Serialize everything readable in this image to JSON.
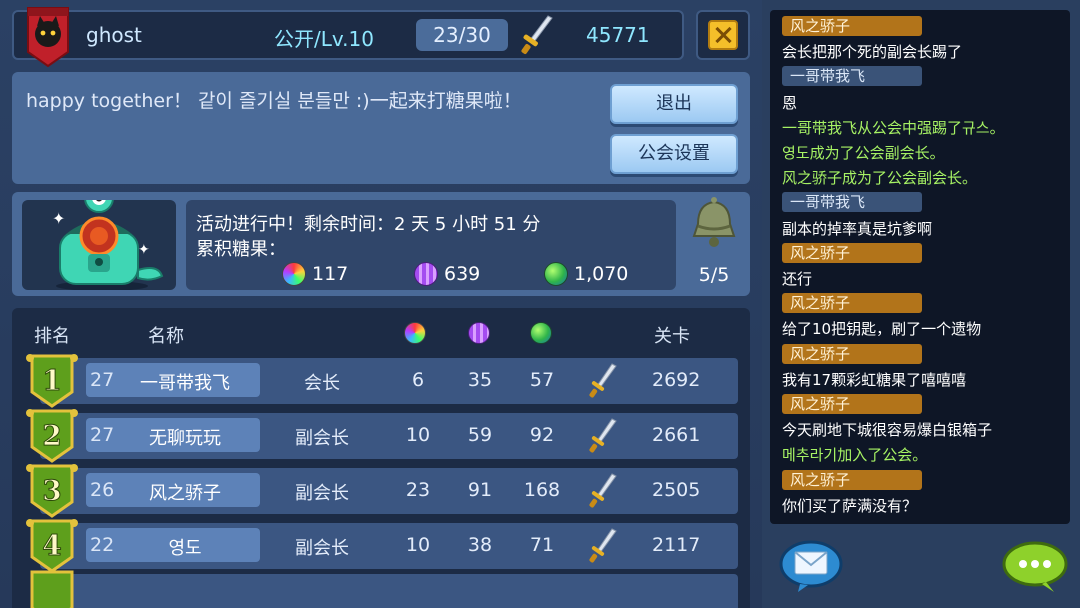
{
  "header": {
    "player_name": "ghost",
    "guild_level": "公开/Lv.10",
    "member_count": "23/30",
    "score": "45771"
  },
  "notice": {
    "text": "happy together！ 같이 즐기실 분들만 :)一起来打糖果啦！",
    "exit_label": "退出",
    "settings_label": "公会设置"
  },
  "activity": {
    "status_text": "活动进行中！剩余时间：2 天 5 小时 51 分",
    "candy_label": "累积糖果：",
    "candy_rainbow": "117",
    "candy_purple": "639",
    "candy_green": "1,070",
    "bell_count": "5/5"
  },
  "table": {
    "col_rank": "排名",
    "col_name": "名称",
    "col_stage": "关卡",
    "rows": [
      {
        "rank": "1",
        "level": "27",
        "name": "一哥带我飞",
        "role": "会长",
        "rainbow": "6",
        "purple": "35",
        "green": "57",
        "stage": "2692"
      },
      {
        "rank": "2",
        "level": "27",
        "name": "无聊玩玩",
        "role": "副会长",
        "rainbow": "10",
        "purple": "59",
        "green": "92",
        "stage": "2661"
      },
      {
        "rank": "3",
        "level": "26",
        "name": "风之骄子",
        "role": "副会长",
        "rainbow": "23",
        "purple": "91",
        "green": "168",
        "stage": "2505"
      },
      {
        "rank": "4",
        "level": "22",
        "name": "영도",
        "role": "副会长",
        "rainbow": "10",
        "purple": "38",
        "green": "71",
        "stage": "2117"
      }
    ]
  },
  "chat": {
    "messages": [
      {
        "kind": "tag",
        "style": "orange",
        "text": "风之骄子"
      },
      {
        "kind": "text",
        "style": "white",
        "text": "会长把那个死的副会长踢了"
      },
      {
        "kind": "tag",
        "style": "blue",
        "text": "一哥带我飞"
      },
      {
        "kind": "text",
        "style": "white",
        "text": "恩"
      },
      {
        "kind": "text",
        "style": "green",
        "text": "一哥带我飞从公会中强踢了규스。"
      },
      {
        "kind": "text",
        "style": "green",
        "text": "영도成为了公会副会长。"
      },
      {
        "kind": "text",
        "style": "green",
        "text": "风之骄子成为了公会副会长。"
      },
      {
        "kind": "tag",
        "style": "blue",
        "text": "一哥带我飞"
      },
      {
        "kind": "text",
        "style": "white",
        "text": "副本的掉率真是坑爹啊"
      },
      {
        "kind": "tag",
        "style": "orange",
        "text": "风之骄子"
      },
      {
        "kind": "text",
        "style": "white",
        "text": "还行"
      },
      {
        "kind": "tag",
        "style": "orange",
        "text": "风之骄子"
      },
      {
        "kind": "text",
        "style": "white",
        "text": "给了10把钥匙，刷了一个遗物"
      },
      {
        "kind": "tag",
        "style": "orange",
        "text": "风之骄子"
      },
      {
        "kind": "text",
        "style": "white",
        "text": "我有17颗彩虹糖果了嘻嘻嘻"
      },
      {
        "kind": "tag",
        "style": "orange",
        "text": "风之骄子"
      },
      {
        "kind": "text",
        "style": "white",
        "text": "今天刷地下城很容易爆白银箱子"
      },
      {
        "kind": "text",
        "style": "green",
        "text": "메추라기加入了公会。"
      },
      {
        "kind": "tag",
        "style": "orange",
        "text": "风之骄子"
      },
      {
        "kind": "text",
        "style": "white",
        "text": "你们买了萨满没有？"
      }
    ]
  },
  "colors": {
    "panel": "#4a6a98",
    "dark_panel": "#1c2b45",
    "tag_orange": "#b2741a",
    "tag_blue": "#3a5378",
    "system_green": "#a6f264",
    "accent_cyan": "#8fe7ff"
  }
}
